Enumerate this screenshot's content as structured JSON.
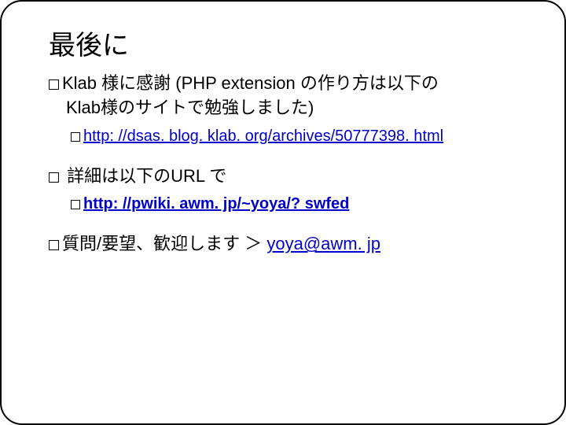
{
  "title": "最後に",
  "b1": {
    "line1": "Klab 様に感謝  (PHP extension の作り方は以下の",
    "line2": "Klab様のサイトで勉強しました)",
    "sub_link": "http: //dsas. blog. klab. org/archives/50777398. html"
  },
  "b2": {
    "text": " 詳細は以下のURL で",
    "sub_link": "http: //pwiki. awm. jp/~yoya/? swfed"
  },
  "b3": {
    "text": "質問/要望、歓迎します ＞ ",
    "email": "yoya@awm. jp"
  }
}
